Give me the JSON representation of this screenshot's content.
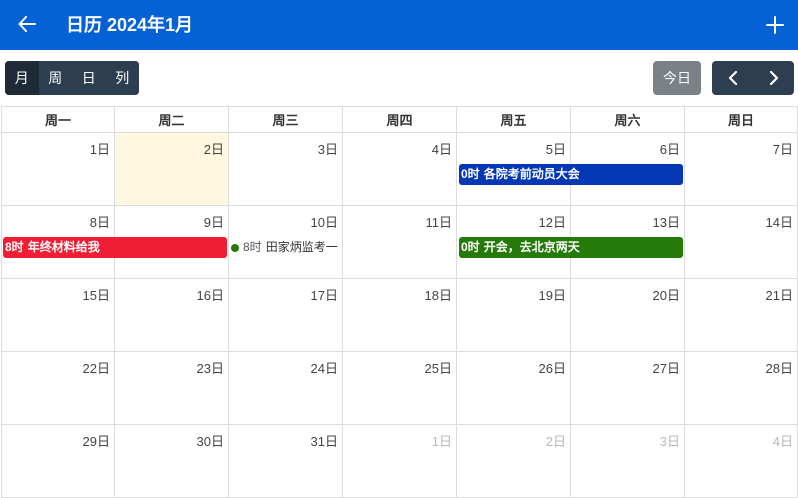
{
  "header": {
    "title": "日历 2024年1月",
    "back_icon": "arrow-left-icon",
    "add_icon": "plus-icon"
  },
  "toolbar": {
    "views": [
      {
        "label": "月",
        "active": true
      },
      {
        "label": "周",
        "active": false
      },
      {
        "label": "日",
        "active": false
      },
      {
        "label": "列",
        "active": false
      }
    ],
    "today_label": "今日",
    "prev_icon": "chevron-left-icon",
    "next_icon": "chevron-right-icon"
  },
  "weekdays": [
    "周一",
    "周二",
    "周三",
    "周四",
    "周五",
    "周六",
    "周日"
  ],
  "weeks": [
    [
      {
        "d": "1日"
      },
      {
        "d": "2日",
        "today": true
      },
      {
        "d": "3日"
      },
      {
        "d": "4日"
      },
      {
        "d": "5日"
      },
      {
        "d": "6日"
      },
      {
        "d": "7日"
      }
    ],
    [
      {
        "d": "8日"
      },
      {
        "d": "9日"
      },
      {
        "d": "10日"
      },
      {
        "d": "11日"
      },
      {
        "d": "12日"
      },
      {
        "d": "13日"
      },
      {
        "d": "14日"
      }
    ],
    [
      {
        "d": "15日"
      },
      {
        "d": "16日"
      },
      {
        "d": "17日"
      },
      {
        "d": "18日"
      },
      {
        "d": "19日"
      },
      {
        "d": "20日"
      },
      {
        "d": "21日"
      }
    ],
    [
      {
        "d": "22日"
      },
      {
        "d": "23日"
      },
      {
        "d": "24日"
      },
      {
        "d": "25日"
      },
      {
        "d": "26日"
      },
      {
        "d": "27日"
      },
      {
        "d": "28日"
      }
    ],
    [
      {
        "d": "29日"
      },
      {
        "d": "30日"
      },
      {
        "d": "31日"
      },
      {
        "d": "1日",
        "other": true
      },
      {
        "d": "2日",
        "other": true
      },
      {
        "d": "3日",
        "other": true
      },
      {
        "d": "4日",
        "other": true
      }
    ]
  ],
  "events": [
    {
      "week": 0,
      "start": 4,
      "span": 2,
      "time": "0时",
      "title": "各院考前动员大会",
      "color": "#0437b3",
      "style": "block"
    },
    {
      "week": 1,
      "start": 0,
      "span": 2,
      "time": "8时",
      "title": "年终材料给我",
      "color": "#f01e35",
      "style": "block"
    },
    {
      "week": 1,
      "start": 2,
      "span": 1,
      "time": "8时",
      "title": "田家炳监考一",
      "color": "#257a09",
      "style": "dot"
    },
    {
      "week": 1,
      "start": 4,
      "span": 2,
      "time": "0时",
      "title": "开会，去北京两天",
      "color": "#257a09",
      "style": "block"
    }
  ]
}
